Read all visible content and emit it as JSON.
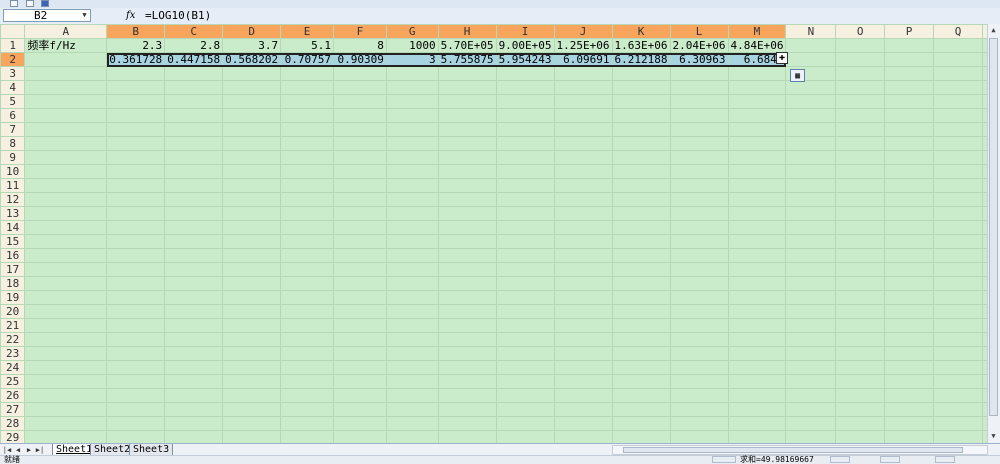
{
  "formula_bar": {
    "name_box": "B2",
    "fx_label": "fx",
    "formula": "=LOG10(B1)"
  },
  "columns": [
    "A",
    "B",
    "C",
    "D",
    "E",
    "F",
    "G",
    "H",
    "I",
    "J",
    "K",
    "L",
    "M",
    "N",
    "O",
    "P",
    "Q"
  ],
  "selected_columns": [
    "B",
    "C",
    "D",
    "E",
    "F",
    "G",
    "H",
    "I",
    "J",
    "K",
    "L",
    "M"
  ],
  "row_count": 29,
  "selected_row": 2,
  "rows": [
    {
      "row": 1,
      "cells": [
        "频率f/Hz",
        "2.3",
        "2.8",
        "3.7",
        "5.1",
        "8",
        "1000",
        "5.70E+05",
        "9.00E+05",
        "1.25E+06",
        "1.63E+06",
        "2.04E+06",
        "4.84E+06",
        "",
        "",
        "",
        ""
      ]
    },
    {
      "row": 2,
      "cells": [
        "",
        "0.361728",
        "0.447158",
        "0.568202",
        "0.70757",
        "0.90309",
        "3",
        "5.755875",
        "5.954243",
        "6.09691",
        "6.212188",
        "6.30963",
        "6.6848",
        "",
        "",
        "",
        ""
      ]
    }
  ],
  "sheet_tabs": [
    {
      "name": "Sheet1",
      "active": true
    },
    {
      "name": "Sheet2",
      "active": false
    },
    {
      "name": "Sheet3",
      "active": false
    }
  ],
  "status": {
    "left_text": "就绪",
    "sum_text": "求和=49.98169667"
  },
  "colors": {
    "cell_bg": "#cbeccb",
    "selected_header": "#f7a45c",
    "selected_cell": "#a8d4e2"
  }
}
